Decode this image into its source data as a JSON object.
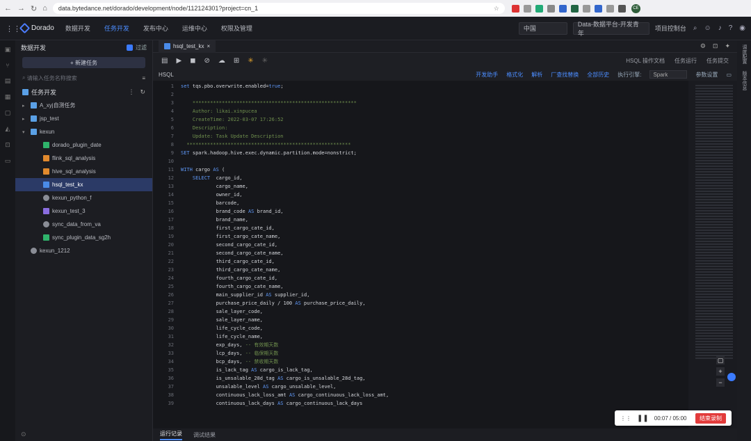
{
  "browser": {
    "url": "data.bytedance.net/dorado/development/node/112124301?project=cn_1",
    "avatar": "CE"
  },
  "app": {
    "logo": "Dorado",
    "menu": [
      "数据开发",
      "任务开发",
      "发布中心",
      "运维中心",
      "权限及管理"
    ],
    "active_menu": "任务开发",
    "region_select": "中国",
    "project_select": "Data-数据平台-开发青年",
    "project_link": "项目控制台"
  },
  "sidebar": {
    "title": "数据开发",
    "checkbox_label": "过滤",
    "new_task": "+ 新建任务",
    "search_placeholder": "请输入任务名称搜索",
    "root": "任务开发",
    "items": [
      {
        "label": "A_xyj自测任务",
        "type": "folder",
        "depth": 0,
        "caret": "▸"
      },
      {
        "label": "jsp_test",
        "type": "folder",
        "depth": 0,
        "caret": "▸"
      },
      {
        "label": "kexun",
        "type": "folder",
        "depth": 0,
        "caret": "▾"
      },
      {
        "label": "dorado_plugin_date",
        "type": "green",
        "depth": 1,
        "caret": ""
      },
      {
        "label": "flink_sql_analysis",
        "type": "orange",
        "depth": 1,
        "caret": ""
      },
      {
        "label": "hive_sql_analysis",
        "type": "orange",
        "depth": 1,
        "caret": ""
      },
      {
        "label": "hsql_test_kx",
        "type": "blue",
        "depth": 1,
        "caret": "",
        "selected": true
      },
      {
        "label": "kexun_python_f",
        "type": "gray",
        "depth": 1,
        "caret": ""
      },
      {
        "label": "kexun_test_3",
        "type": "purple",
        "depth": 1,
        "caret": ""
      },
      {
        "label": "sync_data_from_va",
        "type": "gray",
        "depth": 1,
        "caret": ""
      },
      {
        "label": "sync_plugin_data_sg2h",
        "type": "green",
        "depth": 1,
        "caret": ""
      },
      {
        "label": "kexun_1212",
        "type": "gray",
        "depth": 0,
        "caret": ""
      }
    ]
  },
  "editor": {
    "tab": "hsql_test_kx",
    "toolbar_right": [
      "HSQL 操作文档",
      "任务运行",
      "任务提交"
    ],
    "lang": "HSQL",
    "actions": [
      "开发助手",
      "格式化",
      "解析",
      "厂查找替换",
      "全部历史"
    ],
    "engine_label": "执行引擎:",
    "engine": "Spark",
    "params": "参数设置",
    "code": [
      {
        "n": "1",
        "html": "<span class='c-kw'>set</span> tqs.pbo.overwrite.enabled=<span class='c-kw'>true</span>;"
      },
      {
        "n": "2",
        "html": ""
      },
      {
        "n": "3",
        "html": "<span class='c-comment'>    ********************************************************</span>"
      },
      {
        "n": "4",
        "html": "<span class='c-comment'>    Author: likai.xinpucea</span>"
      },
      {
        "n": "5",
        "html": "<span class='c-comment'>    CreateTime: 2022-03-07 17:26:52</span>"
      },
      {
        "n": "6",
        "html": "<span class='c-comment'>    Description:</span>"
      },
      {
        "n": "7",
        "html": "<span class='c-comment'>    Update: Task Update Description</span>"
      },
      {
        "n": "8",
        "html": "<span class='c-comment'>  ********************************************************</span>"
      },
      {
        "n": "9",
        "html": "<span class='c-kw'>SET</span> spark.hadoop.hive.exec.dynamic.partition.mode=nonstrict;"
      },
      {
        "n": "10",
        "html": ""
      },
      {
        "n": "11",
        "html": "<span class='c-kw'>WITH</span> cargo <span class='c-kw'>AS</span> ("
      },
      {
        "n": "12",
        "html": "    <span class='c-kw'>SELECT</span>  cargo_id,"
      },
      {
        "n": "13",
        "html": "            cargo_name,"
      },
      {
        "n": "14",
        "html": "            owner_id,"
      },
      {
        "n": "15",
        "html": "            barcode,"
      },
      {
        "n": "16",
        "html": "            brand_code <span class='c-kw'>AS</span> brand_id,"
      },
      {
        "n": "17",
        "html": "            brand_name,"
      },
      {
        "n": "18",
        "html": "            first_cargo_cate_id,"
      },
      {
        "n": "19",
        "html": "            first_cargo_cate_name,"
      },
      {
        "n": "20",
        "html": "            second_cargo_cate_id,"
      },
      {
        "n": "21",
        "html": "            second_cargo_cate_name,"
      },
      {
        "n": "22",
        "html": "            third_cargo_cate_id,"
      },
      {
        "n": "23",
        "html": "            third_cargo_cate_name,"
      },
      {
        "n": "24",
        "html": "            fourth_cargo_cate_id,"
      },
      {
        "n": "25",
        "html": "            fourth_cargo_cate_name,"
      },
      {
        "n": "26",
        "html": "            main_supplier_id <span class='c-kw'>AS</span> supplier_id,"
      },
      {
        "n": "27",
        "html": "            purchase_price_daily / 100 <span class='c-kw'>AS</span> purchase_price_daily,"
      },
      {
        "n": "28",
        "html": "            sale_layer_code,"
      },
      {
        "n": "29",
        "html": "            sale_layer_name,"
      },
      {
        "n": "30",
        "html": "            life_cycle_code,"
      },
      {
        "n": "31",
        "html": "            life_cycle_name,"
      },
      {
        "n": "32",
        "html": "            exp_days, <span class='c-comment'>-- 有效期天数</span>"
      },
      {
        "n": "33",
        "html": "            lcp_days, <span class='c-comment'>-- 临保期天数</span>"
      },
      {
        "n": "34",
        "html": "            bcp_days, <span class='c-comment'>-- 禁收期天数</span>"
      },
      {
        "n": "35",
        "html": "            is_lack_tag <span class='c-kw'>AS</span> cargo_is_lack_tag,"
      },
      {
        "n": "36",
        "html": "            is_unsalable_28d_tag <span class='c-kw'>AS</span> cargo_is_unsalable_28d_tag,"
      },
      {
        "n": "37",
        "html": "            unsalable_level <span class='c-kw'>AS</span> cargo_unsalable_level,"
      },
      {
        "n": "38",
        "html": "            continuous_lack_loss_amt <span class='c-kw'>AS</span> cargo_continuous_lack_loss_amt,"
      },
      {
        "n": "39",
        "html": "            continuous_lack_days <span class='c-kw'>AS</span> cargo_continuous_lack_days"
      }
    ]
  },
  "sidetabs": [
    "调度配置",
    "版本信息"
  ],
  "bottom_tabs": [
    "运行记录",
    "调试结果"
  ],
  "recorder": {
    "time": "00:07 / 05:00",
    "stop": "结束录制"
  }
}
